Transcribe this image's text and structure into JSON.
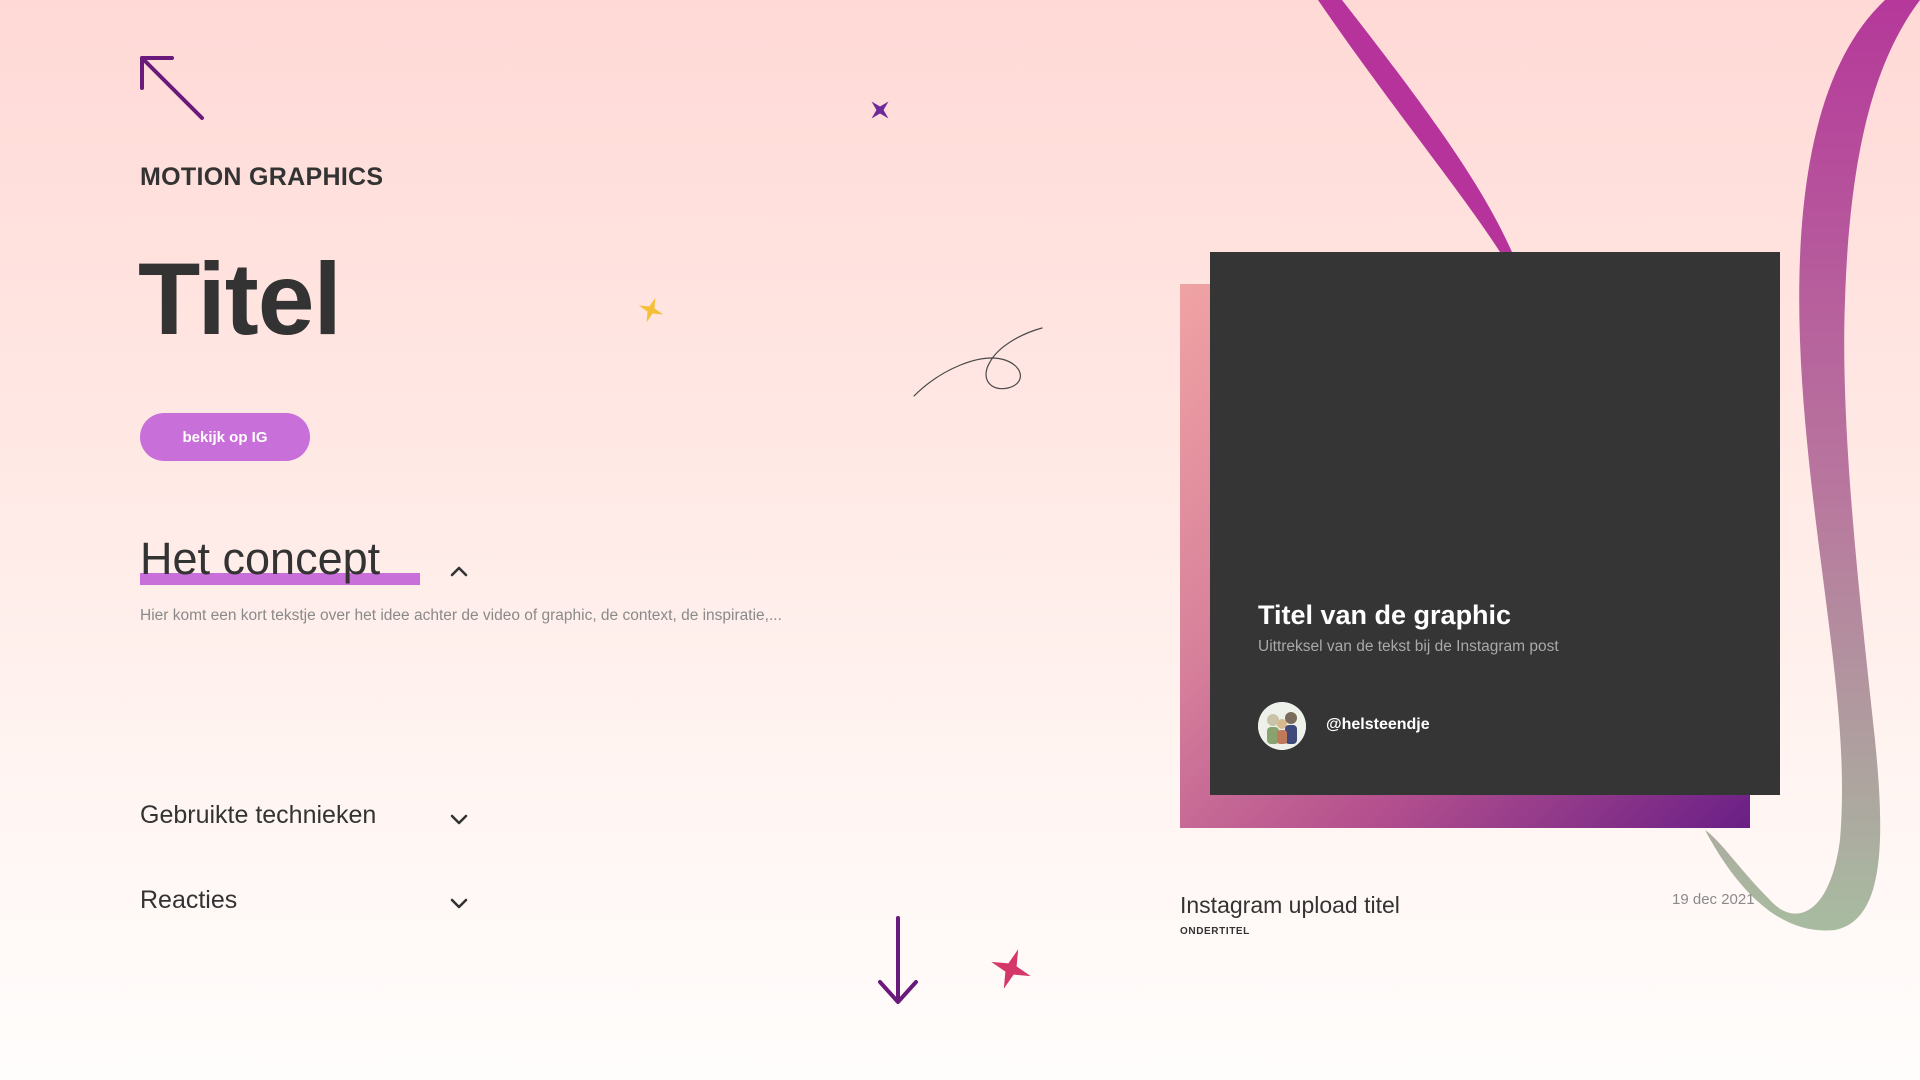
{
  "header": {
    "eyebrow": "MOTION GRAPHICS",
    "title": "Titel",
    "ig_button_label": "bekijk op IG"
  },
  "sections": {
    "concept": {
      "heading": "Het concept",
      "description": "Hier komt een kort tekstje over het idee achter de video of graphic, de context, de inspiratie,..."
    },
    "techniques": {
      "heading": "Gebruikte technieken"
    },
    "reactions": {
      "heading": "Reacties"
    }
  },
  "card": {
    "title": "Titel van de graphic",
    "excerpt": "Uittreksel van de tekst bij de Instagram post",
    "handle": "@helsteendje"
  },
  "upload": {
    "title": "Instagram upload titel",
    "subtitle": "ONDERTITEL",
    "date": "19 dec 2021"
  },
  "colors": {
    "accent": "#c96fd9",
    "deep_purple": "#6a1a7a",
    "card_bg": "#353535",
    "sparkle_yellow": "#f5bf3a",
    "sparkle_pink": "#d4386a"
  },
  "icons": {
    "back": "arrow-up-left-icon",
    "concept_toggle": "chevron-up-icon",
    "techniques_toggle": "chevron-down-icon",
    "reactions_toggle": "chevron-down-icon",
    "scroll": "arrow-down-icon"
  }
}
